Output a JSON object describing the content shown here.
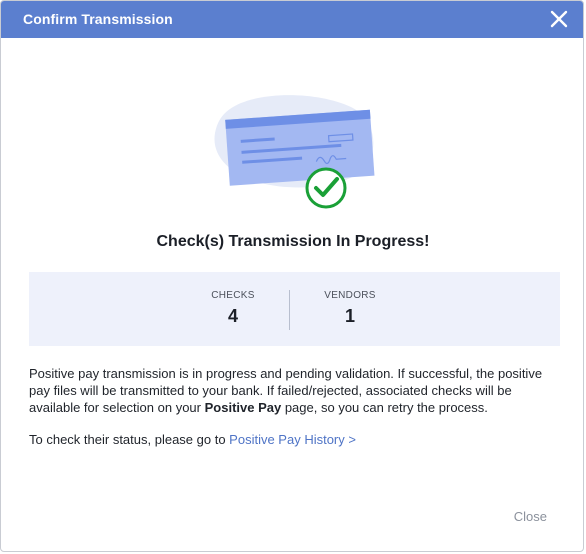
{
  "header": {
    "title": "Confirm Transmission",
    "close_icon": "close-icon"
  },
  "illustration": {
    "icon": "check-with-checkmark-icon",
    "colors": {
      "blob": "#e6ebf8",
      "check_body": "#9cb4f3",
      "check_stripe": "#6e8fe6",
      "success_green": "#1aa037"
    }
  },
  "main": {
    "title": "Check(s) Transmission In Progress!",
    "stats": [
      {
        "label": "CHECKS",
        "value": "4"
      },
      {
        "label": "VENDORS",
        "value": "1"
      }
    ],
    "description": {
      "part1": "Positive pay transmission is in progress and pending validation. If successful, the positive pay files will be transmitted to your bank. If failed/rejected, associated checks will be available for selection on your ",
      "bold": "Positive Pay",
      "part2": " page, so you can retry the process."
    },
    "status_prefix": "To check their status, please go to ",
    "status_link": "Positive Pay History >"
  },
  "footer": {
    "close_label": "Close"
  },
  "colors": {
    "header_bg": "#5b7fcf",
    "stats_bg": "#eef1fb",
    "link": "#4f74c6"
  }
}
